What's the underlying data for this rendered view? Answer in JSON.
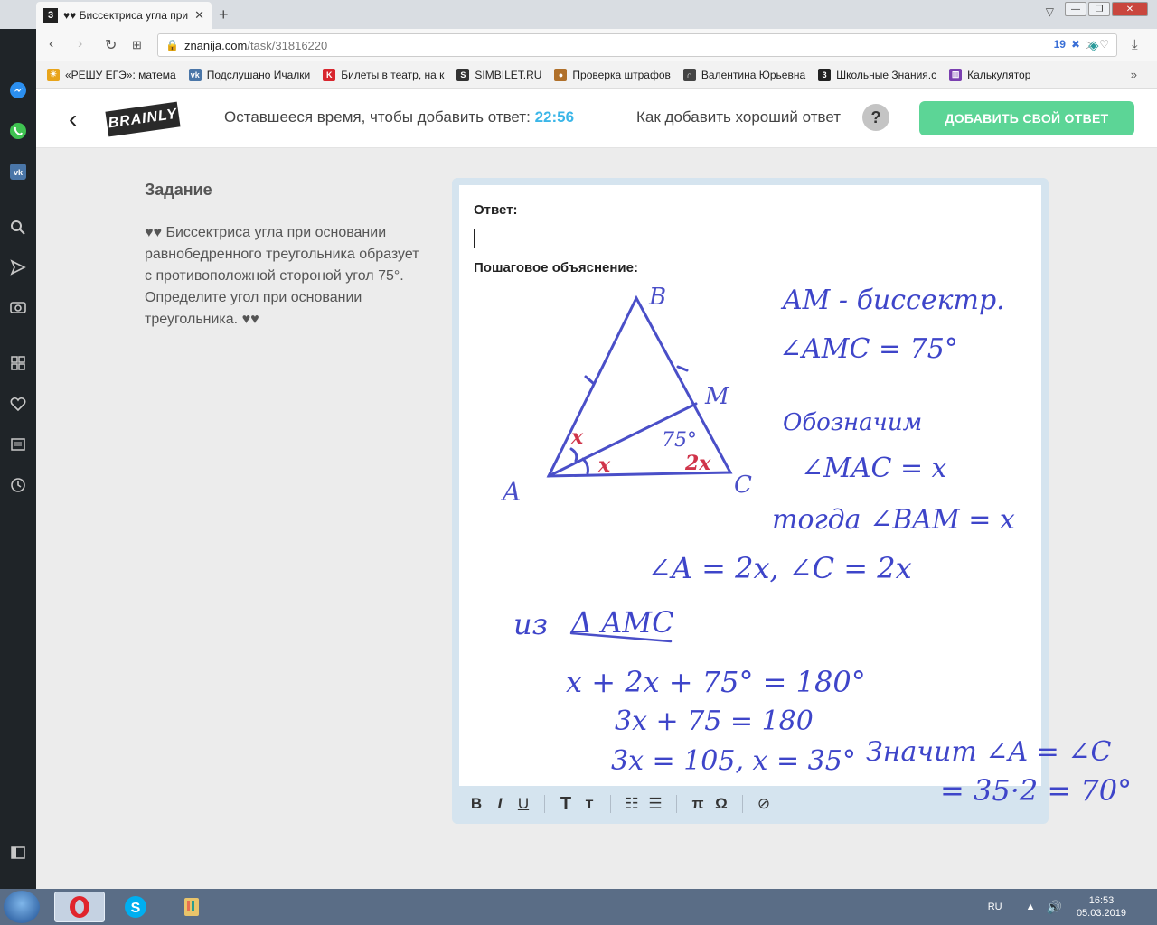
{
  "browser": {
    "tab_title": "♥♥ Биссектриса угла при",
    "tab_favicon": "3",
    "url_domain": "znanija.com",
    "url_path": "/task/31816220",
    "badge_count": "19"
  },
  "bookmarks": [
    {
      "label": "«РЕШУ ЕГЭ»: матема",
      "icon": "sun-icon",
      "color": "#e8a41a"
    },
    {
      "label": "Подслушано Ичалки",
      "icon": "vk-icon",
      "color": "#4a76a8"
    },
    {
      "label": "Билеты в театр, на к",
      "icon": "k-icon",
      "color": "#d8262e"
    },
    {
      "label": "SIMBILET.RU",
      "icon": "sim-icon",
      "color": "#333333"
    },
    {
      "label": "Проверка штрафов",
      "icon": "badge-icon",
      "color": "#b0702a"
    },
    {
      "label": "Валентина Юрьевна",
      "icon": "headphones-icon",
      "color": "#444444"
    },
    {
      "label": "Школьные Знания.c",
      "icon": "znanija-icon",
      "color": "#222222"
    },
    {
      "label": "Калькулятор",
      "icon": "calculator-icon",
      "color": "#7a3fb0"
    }
  ],
  "header": {
    "timer_label": "Оставшееся время, чтобы добавить ответ:",
    "timer_value": "22:56",
    "howto_label": "Как добавить хороший ответ",
    "help_symbol": "?",
    "add_answer_label": "ДОБАВИТЬ СВОЙ ОТВЕТ",
    "logo_text": "BRAINLY"
  },
  "task": {
    "heading": "Задание",
    "text": "♥♥ Биссектриса угла при основании равнобедренного треугольника образует с противоположной стороной угол 75°. Определите угол при основании треугольника. ♥♥"
  },
  "editor": {
    "answer_label": "Ответ:",
    "explanation_label": "Пошаговое объяснение:",
    "handwriting": {
      "vertex_b": "B",
      "vertex_m": "M",
      "vertex_a": "A",
      "vertex_c": "C",
      "angle_x1": "x",
      "angle_x2": "x",
      "angle_75": "75°",
      "angle_2x": "2x",
      "line1": "AM - биссектр.",
      "line2": "∠AMC = 75°",
      "line3": "Обозначим",
      "line4": "∠MAC = x",
      "line5": "тогда ∠BAM = x",
      "line6": "∠A = 2x,  ∠C = 2x",
      "line7_prefix": "из",
      "line7_tri": "Δ AMC",
      "line8": "x + 2x + 75° = 180°",
      "line9": "3x + 75 = 180",
      "line10": "3x = 105,   x = 35°",
      "line11": "Значит ∠A = ∠C",
      "line12": "= 35·2 = 70°"
    },
    "toolbar": {
      "bold": "B",
      "italic": "I",
      "underline": "U",
      "text_large": "T",
      "text_small": "T",
      "pi": "π",
      "omega": "Ω"
    }
  },
  "taskbar": {
    "lang": "RU",
    "time": "16:53",
    "date": "05.03.2019"
  }
}
